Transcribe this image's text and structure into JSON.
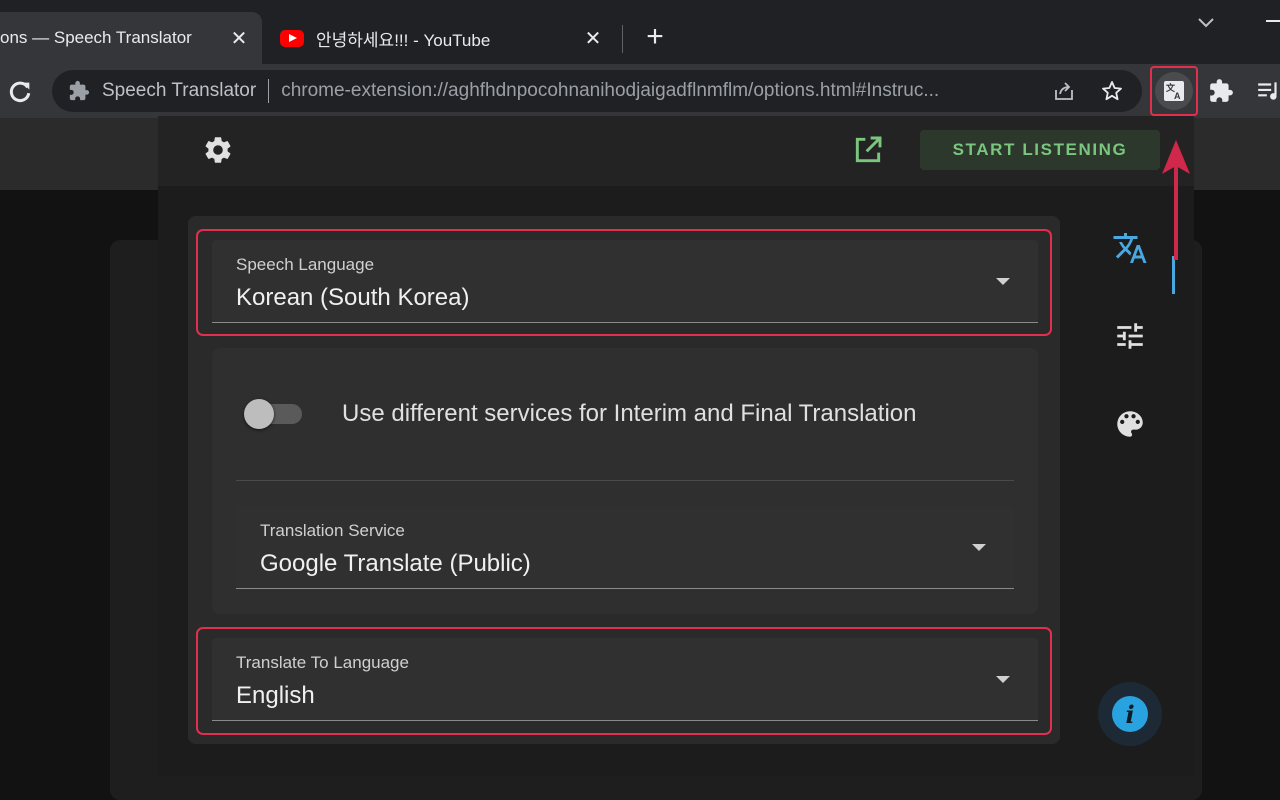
{
  "browser": {
    "tabs": [
      {
        "title": "ons — Speech Translator",
        "active": true
      },
      {
        "title": "안녕하세요!!! - YouTube",
        "active": false
      }
    ],
    "new_tab_label": "+",
    "omnibox": {
      "site_name": "Speech Translator",
      "url": "chrome-extension://aghfhdnpocohnanihodjaigadflnmflm/options.html#Instruc..."
    }
  },
  "popup": {
    "start_button_label": "START LISTENING",
    "speech_language": {
      "label": "Speech Language",
      "value": "Korean (South Korea)"
    },
    "toggle": {
      "label": "Use different services for Interim and Final Translation",
      "checked": false
    },
    "translation_service": {
      "label": "Translation Service",
      "value": "Google Translate (Public)"
    },
    "translate_to": {
      "label": "Translate To Language",
      "value": "English"
    },
    "side_nav": [
      {
        "icon": "translate-icon",
        "active": true
      },
      {
        "icon": "tune-icon",
        "active": false
      },
      {
        "icon": "palette-icon",
        "active": false
      }
    ],
    "info_fab_icon": "info-icon"
  },
  "colors": {
    "highlight": "#e0304e",
    "accent_green": "#7bc67e",
    "accent_blue": "#4aa8e0",
    "youtube_red": "#ff0000"
  }
}
